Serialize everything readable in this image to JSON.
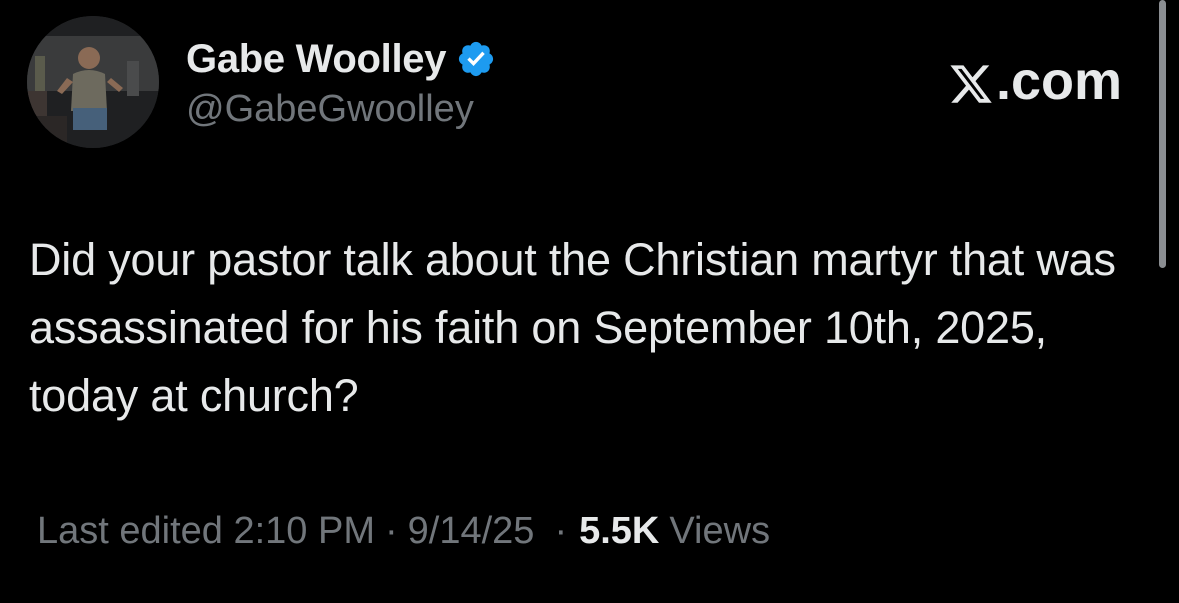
{
  "author": {
    "display_name": "Gabe Woolley",
    "handle": "@GabeGwoolley",
    "verified": true,
    "avatar_icon": "profile-photo"
  },
  "brand": {
    "label": ".com",
    "logo_icon": "x-logo-icon"
  },
  "tweet": {
    "text": "Did your pastor talk about the Christian martyr that was assassinated for his faith on September 10th, 2025, today at church?"
  },
  "meta": {
    "edited_label": "Last edited 2:10 PM",
    "separator": "·",
    "date": "9/14/25",
    "views_count": "5.5K",
    "views_label": "Views"
  },
  "colors": {
    "background": "#000000",
    "primary_text": "#e7e9ea",
    "secondary_text": "#71767b",
    "verified_blue": "#1d9bf0"
  }
}
